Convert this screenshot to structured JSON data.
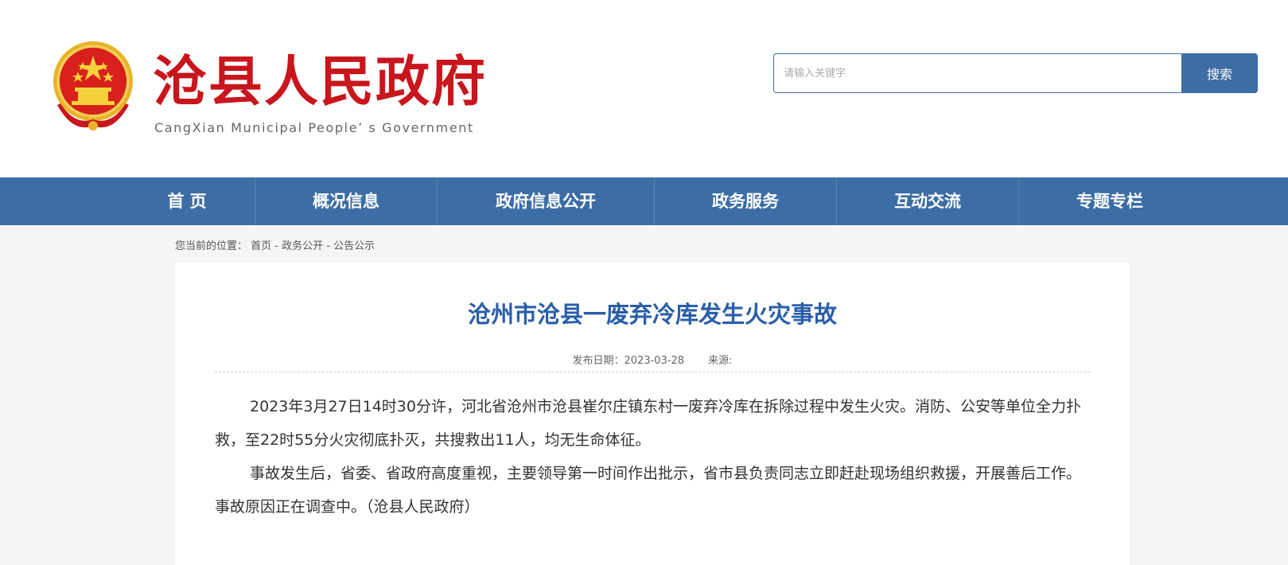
{
  "site": {
    "title": "沧县人民政府",
    "subtitle": "CangXian Municipal People’ s Government",
    "emblem_icon": "national-emblem-icon",
    "brand_red": "#c8161d",
    "brand_blue": "#3c6da4"
  },
  "search": {
    "placeholder": "请输入关键字",
    "button_label": "搜索"
  },
  "nav": {
    "items": [
      {
        "label": "首 页"
      },
      {
        "label": "概况信息"
      },
      {
        "label": "政府信息公开"
      },
      {
        "label": "政务服务"
      },
      {
        "label": "互动交流"
      },
      {
        "label": "专题专栏"
      }
    ]
  },
  "breadcrumb": {
    "prefix": "您当前的位置：",
    "items": [
      "首页",
      "政务公开",
      "公告公示"
    ],
    "separator": " - "
  },
  "article": {
    "title": "沧州市沧县一废弃冷库发生火灾事故",
    "date_label": "发布日期：2023-03-28",
    "source_label": "来源:",
    "paragraphs": [
      "2023年3月27日14时30分许，河北省沧州市沧县崔尔庄镇东村一废弃冷库在拆除过程中发生火灾。消防、公安等单位全力扑救，至22时55分火灾彻底扑灭，共搜救出11人，均无生命体征。",
      "事故发生后，省委、省政府高度重视，主要领导第一时间作出批示，省市县负责同志立即赶赴现场组织救援，开展善后工作。事故原因正在调查中。（沧县人民政府）"
    ]
  }
}
